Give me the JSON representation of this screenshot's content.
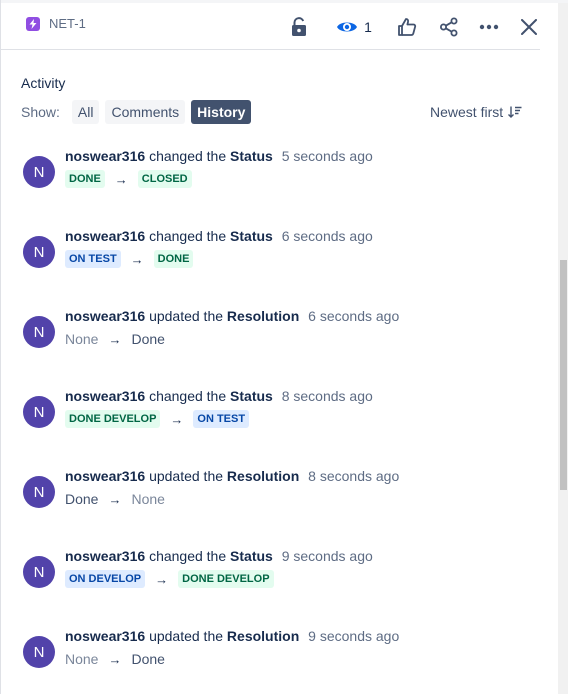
{
  "header": {
    "issue_key": "NET-1",
    "issue_type_icon": "lightning-icon",
    "issue_type_color": "#904ee2",
    "watch_count": "1",
    "icons": [
      "unlock-icon",
      "eye-icon",
      "thumbs-up-icon",
      "share-icon",
      "more-icon",
      "close-icon"
    ]
  },
  "activity": {
    "title": "Activity",
    "show_label": "Show:",
    "filters": [
      "All",
      "Comments",
      "History"
    ],
    "active_filter": "History",
    "sort_label": "Newest first"
  },
  "entries": [
    {
      "avatar": "N",
      "user": "noswear316",
      "verb": "changed the",
      "field": "Status",
      "time": "5 seconds ago",
      "from": "DONE",
      "to": "CLOSED",
      "from_style": "done",
      "to_style": "done"
    },
    {
      "avatar": "N",
      "user": "noswear316",
      "verb": "changed the",
      "field": "Status",
      "time": "6 seconds ago",
      "from": "ON TEST",
      "to": "DONE",
      "from_style": "test",
      "to_style": "done"
    },
    {
      "avatar": "N",
      "user": "noswear316",
      "verb": "updated the",
      "field": "Resolution",
      "time": "6 seconds ago",
      "from": "None",
      "to": "Done",
      "from_style": "plain-old",
      "to_style": "plain-new"
    },
    {
      "avatar": "N",
      "user": "noswear316",
      "verb": "changed the",
      "field": "Status",
      "time": "8 seconds ago",
      "from": "DONE DEVELOP",
      "to": "ON TEST",
      "from_style": "done",
      "to_style": "test"
    },
    {
      "avatar": "N",
      "user": "noswear316",
      "verb": "updated the",
      "field": "Resolution",
      "time": "8 seconds ago",
      "from": "Done",
      "to": "None",
      "from_style": "plain-new",
      "to_style": "plain-old"
    },
    {
      "avatar": "N",
      "user": "noswear316",
      "verb": "changed the",
      "field": "Status",
      "time": "9 seconds ago",
      "from": "ON DEVELOP",
      "to": "DONE DEVELOP",
      "from_style": "test",
      "to_style": "done"
    },
    {
      "avatar": "N",
      "user": "noswear316",
      "verb": "updated the",
      "field": "Resolution",
      "time": "9 seconds ago",
      "from": "None",
      "to": "Done",
      "from_style": "plain-old",
      "to_style": "plain-new"
    }
  ],
  "arrow_symbol": "→",
  "colors": {
    "avatar_bg": "#5243aa",
    "done_lozenge_bg": "#e3fcef",
    "done_lozenge_text": "#006644",
    "test_lozenge_bg": "#deebff",
    "test_lozenge_text": "#0747a6",
    "active_filter_bg": "#42526e"
  }
}
